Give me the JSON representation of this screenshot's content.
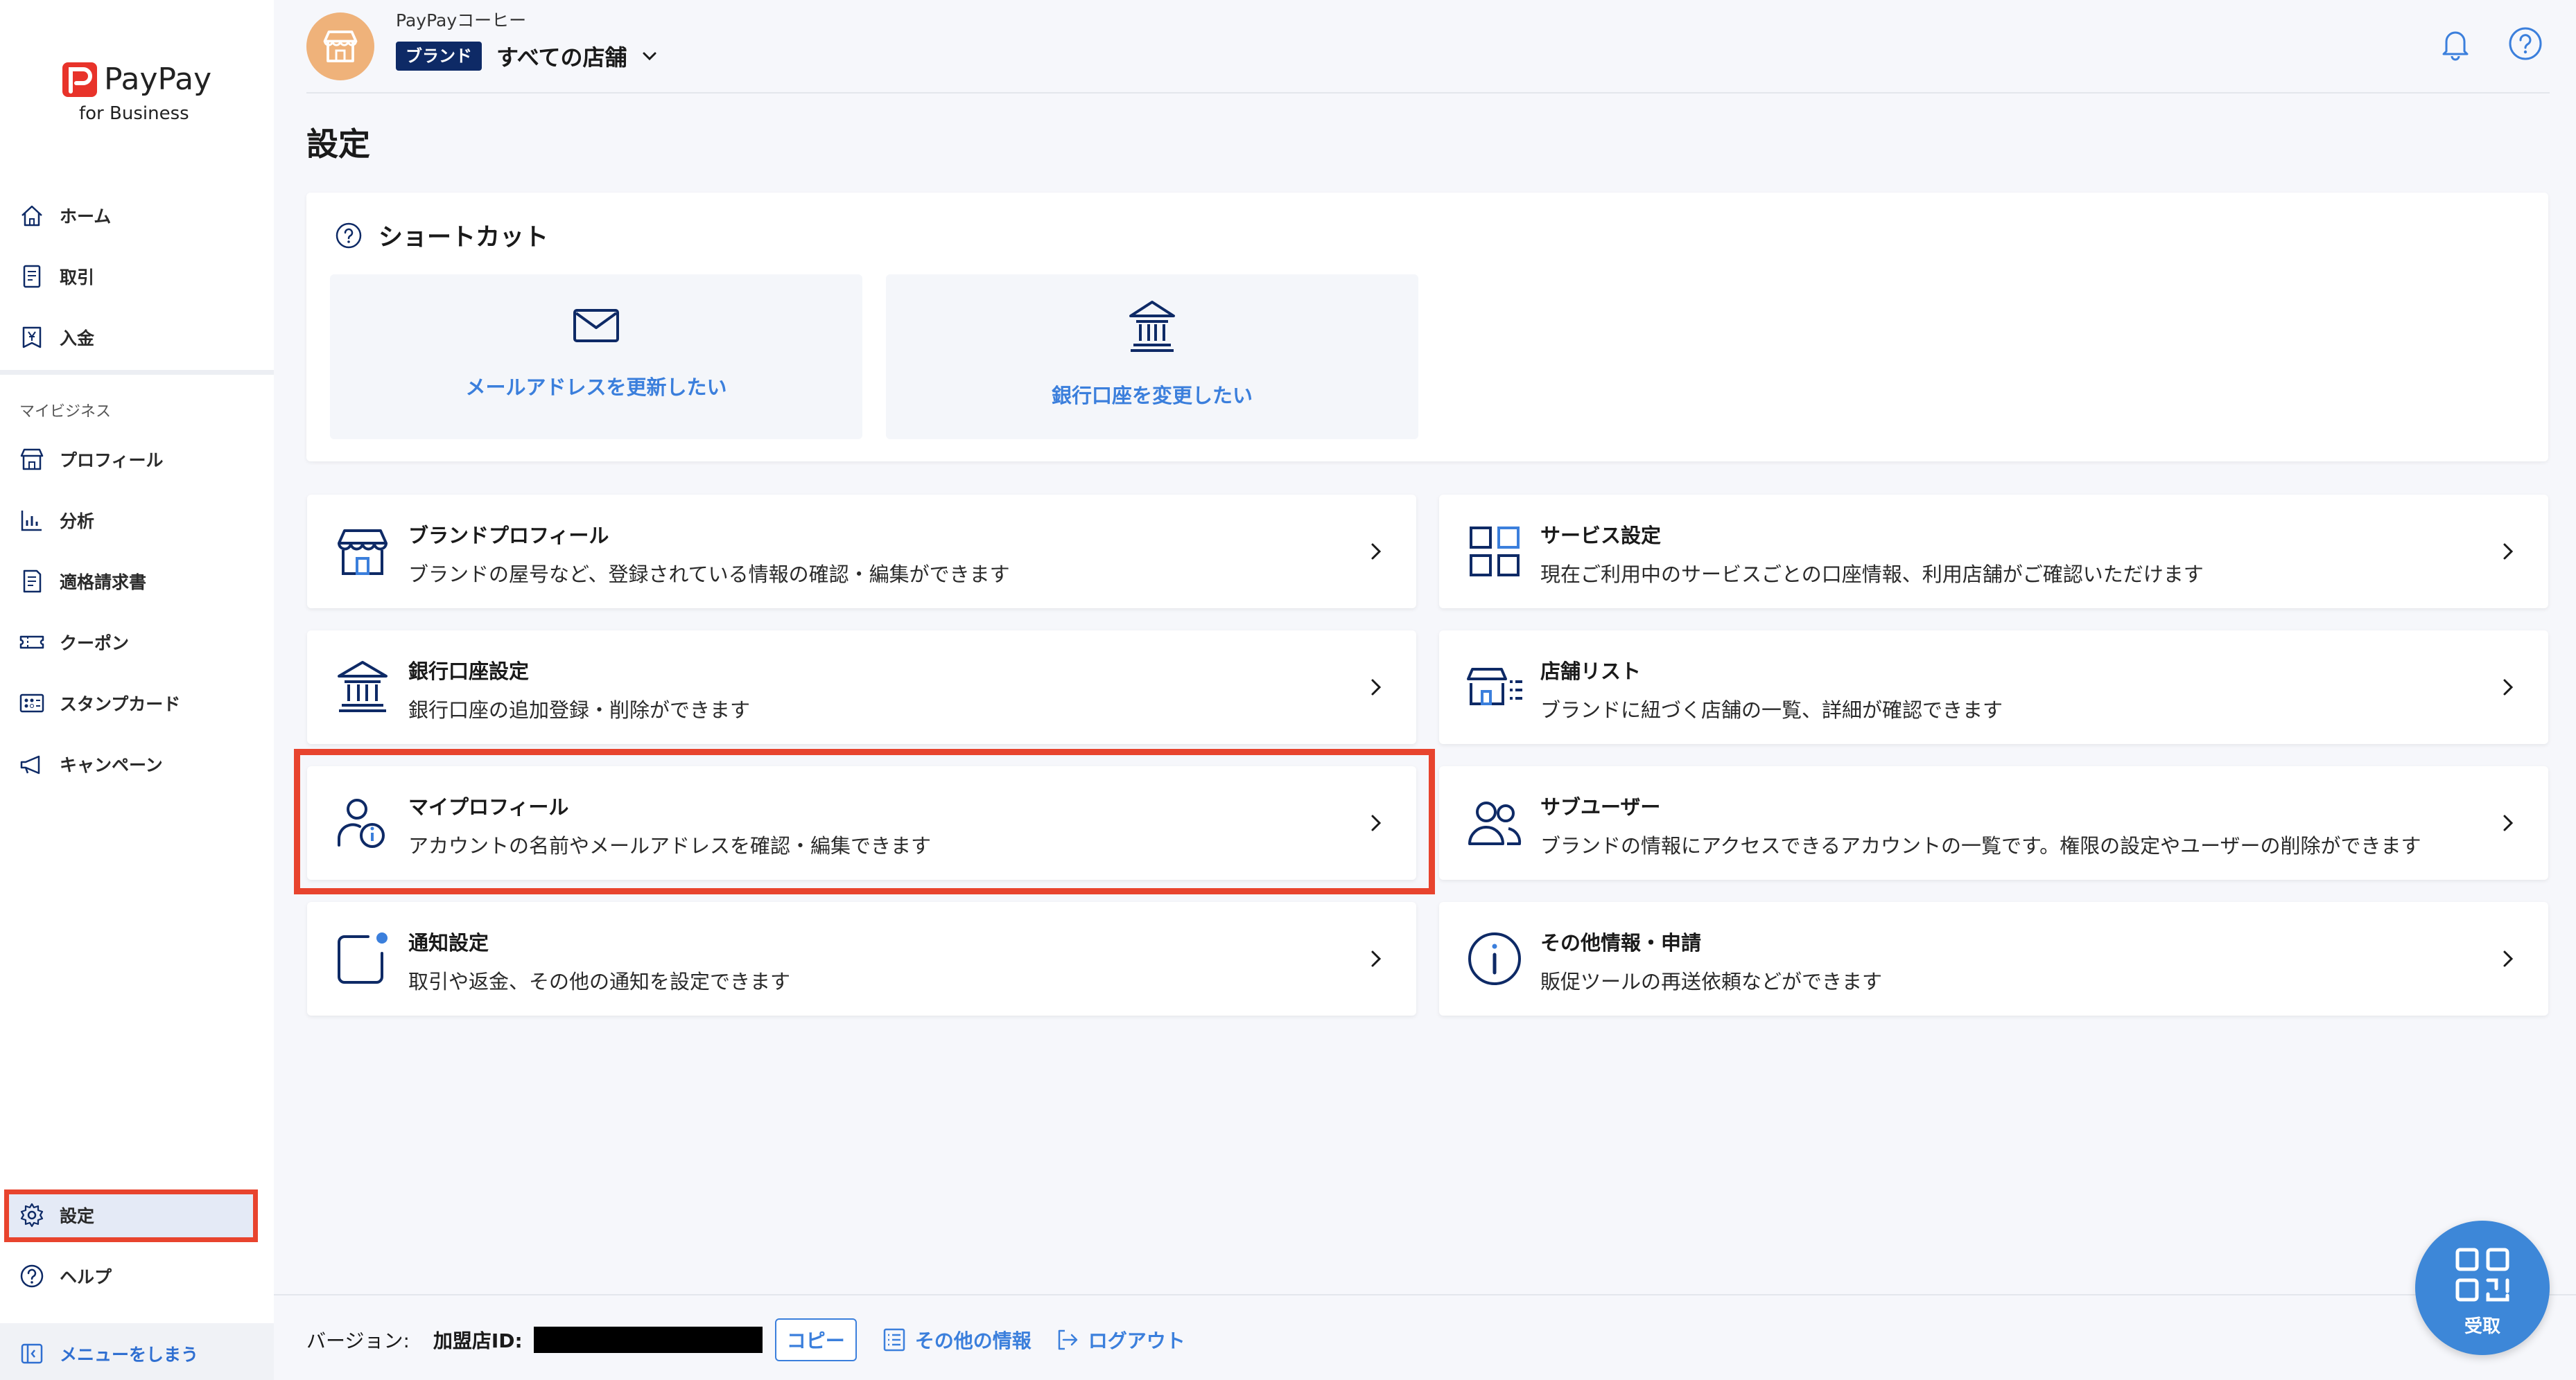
{
  "brand": {
    "logo_text": "PayPay",
    "logo_sub": "for Business"
  },
  "sidebar": {
    "items": [
      {
        "label": "ホーム",
        "icon": "home-icon"
      },
      {
        "label": "取引",
        "icon": "receipt-icon"
      },
      {
        "label": "入金",
        "icon": "deposit-icon"
      }
    ],
    "section_label": "マイビジネス",
    "business_items": [
      {
        "label": "プロフィール",
        "icon": "store-icon"
      },
      {
        "label": "分析",
        "icon": "chart-icon"
      },
      {
        "label": "適格請求書",
        "icon": "invoice-icon"
      },
      {
        "label": "クーポン",
        "icon": "coupon-icon"
      },
      {
        "label": "スタンプカード",
        "icon": "stamp-card-icon"
      },
      {
        "label": "キャンペーン",
        "icon": "megaphone-icon"
      }
    ],
    "settings_label": "設定",
    "help_label": "ヘルプ",
    "collapse_label": "メニューをしまう"
  },
  "header": {
    "company_name": "PayPayコーヒー",
    "brand_badge": "ブランド",
    "store_selector": "すべての店舗"
  },
  "page": {
    "title": "設定"
  },
  "shortcuts": {
    "heading": "ショートカット",
    "items": [
      {
        "label": "メールアドレスを更新したい",
        "icon": "mail-icon"
      },
      {
        "label": "銀行口座を変更したい",
        "icon": "bank-icon"
      }
    ]
  },
  "cards": [
    {
      "title": "ブランドプロフィール",
      "desc": "ブランドの屋号など、登録されている情報の確認・編集ができます",
      "icon": "store-icon"
    },
    {
      "title": "サービス設定",
      "desc": "現在ご利用中のサービスごとの口座情報、利用店舗がご確認いただけます",
      "icon": "grid-icon"
    },
    {
      "title": "銀行口座設定",
      "desc": "銀行口座の追加登録・削除ができます",
      "icon": "bank-icon"
    },
    {
      "title": "店舗リスト",
      "desc": "ブランドに紐づく店舗の一覧、詳細が確認できます",
      "icon": "store-list-icon"
    },
    {
      "title": "マイプロフィール",
      "desc": "アカウントの名前やメールアドレスを確認・編集できます",
      "icon": "user-info-icon"
    },
    {
      "title": "サブユーザー",
      "desc": "ブランドの情報にアクセスできるアカウントの一覧です。権限の設定やユーザーの削除ができます",
      "icon": "users-icon"
    },
    {
      "title": "通知設定",
      "desc": "取引や返金、その他の通知を設定できます",
      "icon": "notification-icon"
    },
    {
      "title": "その他情報・申請",
      "desc": "販促ツールの再送依頼などができます",
      "icon": "info-icon"
    }
  ],
  "footer": {
    "version_label": "バージョン:",
    "merchant_id_label": "加盟店ID:",
    "copy_label": "コピー",
    "other_info_label": "その他の情報",
    "logout_label": "ログアウト"
  },
  "fab": {
    "label": "受取",
    "icon": "qr-icon"
  },
  "colors": {
    "accent": "#3b7fdc",
    "navy": "#0e2a66",
    "highlight": "#e8442e",
    "avatar": "#efb27a",
    "logo_red": "#e8332a"
  }
}
